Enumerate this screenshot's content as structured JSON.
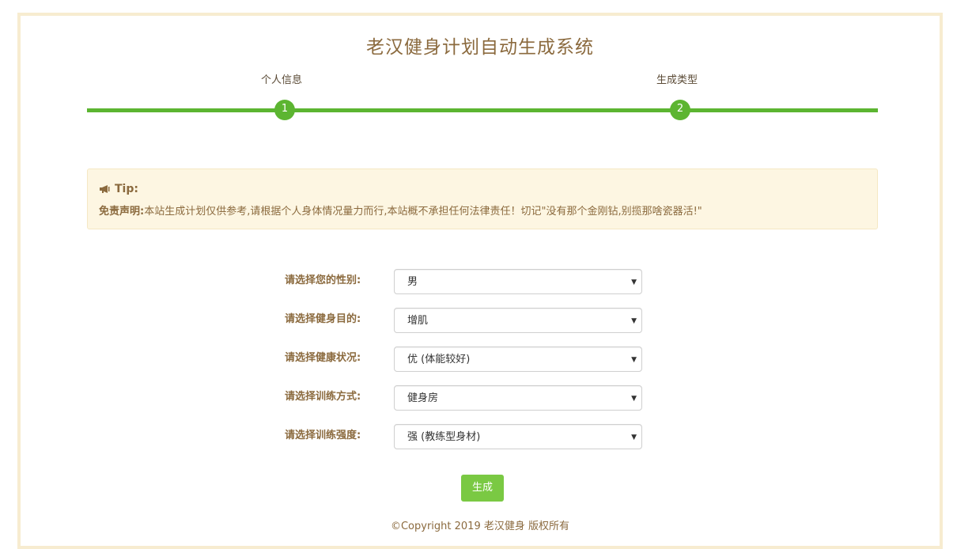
{
  "page": {
    "title": "老汉健身计划自动生成系统"
  },
  "steps": [
    {
      "label": "个人信息",
      "number": "1"
    },
    {
      "label": "生成类型",
      "number": "2"
    }
  ],
  "tip": {
    "heading": "Tip:",
    "disclaimer_label": "免责声明:",
    "disclaimer_text": "本站生成计划仅供参考,请根据个人身体情况量力而行,本站概不承担任何法律责任！切记\"没有那个金刚钻,别揽那啥瓷器活!\""
  },
  "form": {
    "fields": [
      {
        "label": "请选择您的性别:",
        "value": "男"
      },
      {
        "label": "请选择健身目的:",
        "value": "增肌"
      },
      {
        "label": "请选择健康状况:",
        "value": "优 (体能较好)"
      },
      {
        "label": "请选择训练方式:",
        "value": "健身房"
      },
      {
        "label": "请选择训练强度:",
        "value": "强 (教练型身材)"
      }
    ],
    "submit_label": "生成"
  },
  "footer": {
    "copyright": "©Copyright 2019 老汉健身 版权所有"
  },
  "colors": {
    "accent_green": "#5cb531",
    "button_green": "#7ac943",
    "text_brown": "#8b6a3e",
    "tip_bg": "#fdf6e2",
    "frame_border": "#f7ecd0"
  },
  "icons": {
    "tip": "megaphone-icon",
    "select_caret": "caret-down-icon"
  }
}
